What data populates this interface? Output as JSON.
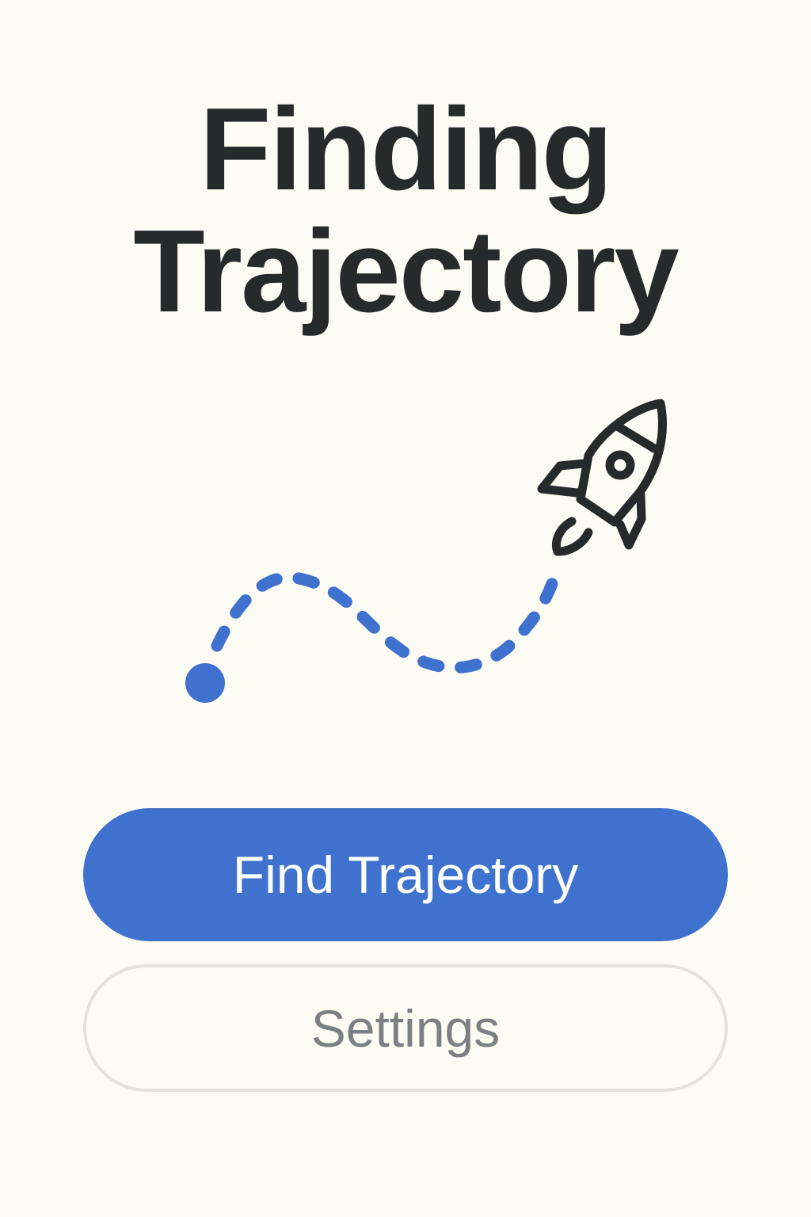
{
  "title": {
    "line1": "Finding",
    "line2": "Trajectory"
  },
  "actions": {
    "primary_label": "Find Trajectory",
    "secondary_label": "Settings"
  },
  "illustration": {
    "icon": "rocket-icon",
    "path_style": "dashed",
    "start_marker": "dot"
  },
  "colors": {
    "background": "#FCFBF4",
    "accent": "#3F72CE",
    "text": "#262A2B",
    "secondary_text": "#7C8083",
    "secondary_border": "#E4E3DD"
  }
}
